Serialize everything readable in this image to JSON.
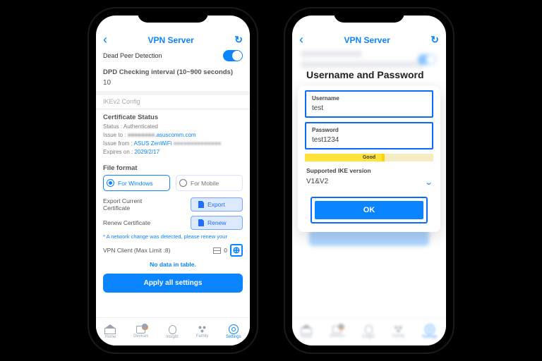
{
  "header": {
    "title": "VPN Server"
  },
  "left": {
    "dpd_label": "Dead Peer Detection",
    "dpd_interval_label": "DPD Checking interval (10~900 seconds)",
    "dpd_interval_value": "10",
    "ikev2_config": "IKEv2 Config",
    "cert_status_label": "Certificate Status",
    "cert_status_line": "Status : Authenticated",
    "cert_issue_to_pre": "Issue to : ",
    "cert_issue_to_link": "asuscomm.com",
    "cert_issue_from_pre": "Issue from : ",
    "cert_issue_from_link": "ASUS ZenWiFi",
    "cert_expires": "Expires on : 2029/2/17",
    "file_format_label": "File format",
    "radio_windows": "For Windows",
    "radio_mobile": "For Mobile",
    "export_label": "Export Current Certificate",
    "export_btn": "Export",
    "renew_label": "Renew Certificate",
    "renew_btn": "Renew",
    "note": "* A network change was detected, please renew your",
    "vpn_client_label": "VPN Client (Max Limit :8)",
    "vpn_client_count": "0",
    "no_data": "No data in table.",
    "apply": "Apply all settings"
  },
  "right": {
    "modal_title": "Username and Password",
    "username_label": "Username",
    "username_value": "test",
    "password_label": "Password",
    "password_value": "test1234",
    "strength": "Good",
    "ike_label": "Supported IKE version",
    "ike_value": "V1&V2",
    "ok": "OK"
  },
  "tabs": {
    "home": "Home",
    "devices": "Devices",
    "devices_badge": "1",
    "insight": "Insight",
    "family": "Family",
    "settings": "Settings"
  }
}
